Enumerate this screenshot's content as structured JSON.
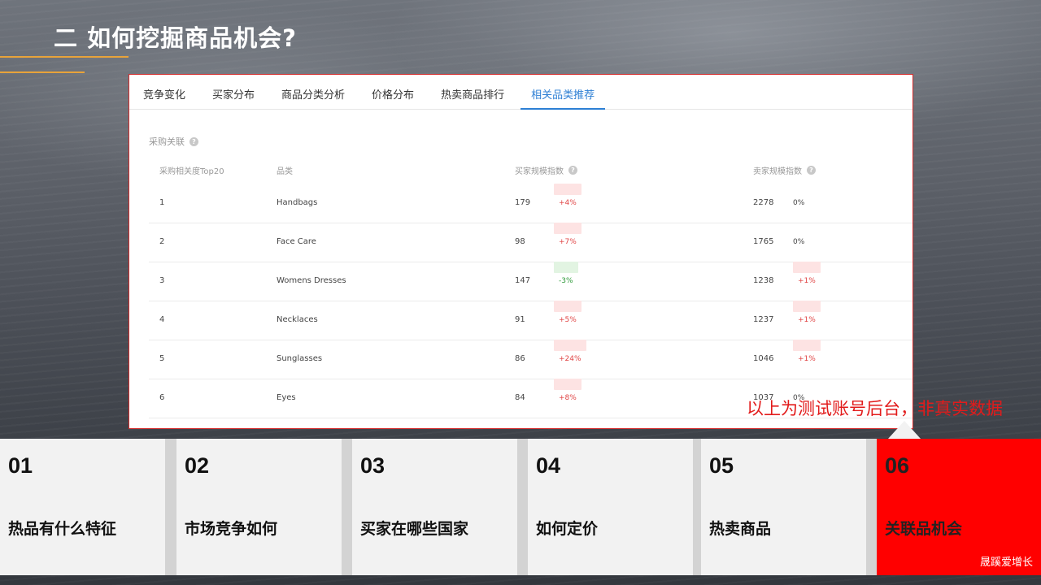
{
  "slide": {
    "title": "二 如何挖掘商品机会?",
    "disclaimer": "以上为测试账号后台，非真实数据",
    "brand": "晟蹊爱增长"
  },
  "tabs": [
    {
      "label": "竞争变化",
      "active": false
    },
    {
      "label": "买家分布",
      "active": false
    },
    {
      "label": "商品分类分析",
      "active": false
    },
    {
      "label": "价格分布",
      "active": false
    },
    {
      "label": "热卖商品排行",
      "active": false
    },
    {
      "label": "相关品类推荐",
      "active": true
    }
  ],
  "section": {
    "title": "采购关联",
    "headers": {
      "rank": "采购相关度Top20",
      "category": "品类",
      "buyer_index": "买家规模指数",
      "seller_index": "卖家规模指数"
    }
  },
  "rows": [
    {
      "rank": "1",
      "category": "Handbags",
      "buyer": "179",
      "buyer_change": "+4%",
      "buyer_trend": "up",
      "seller": "2278",
      "seller_change": "0%",
      "seller_trend": "flat"
    },
    {
      "rank": "2",
      "category": "Face Care",
      "buyer": "98",
      "buyer_change": "+7%",
      "buyer_trend": "up",
      "seller": "1765",
      "seller_change": "0%",
      "seller_trend": "flat"
    },
    {
      "rank": "3",
      "category": "Womens Dresses",
      "buyer": "147",
      "buyer_change": "-3%",
      "buyer_trend": "down",
      "seller": "1238",
      "seller_change": "+1%",
      "seller_trend": "up"
    },
    {
      "rank": "4",
      "category": "Necklaces",
      "buyer": "91",
      "buyer_change": "+5%",
      "buyer_trend": "up",
      "seller": "1237",
      "seller_change": "+1%",
      "seller_trend": "up"
    },
    {
      "rank": "5",
      "category": "Sunglasses",
      "buyer": "86",
      "buyer_change": "+24%",
      "buyer_trend": "up",
      "seller": "1046",
      "seller_change": "+1%",
      "seller_trend": "up"
    },
    {
      "rank": "6",
      "category": "Eyes",
      "buyer": "84",
      "buyer_change": "+8%",
      "buyer_trend": "up",
      "seller": "1037",
      "seller_change": "0%",
      "seller_trend": "flat"
    }
  ],
  "nav_cards": [
    {
      "num": "01",
      "label": "热品有什么特征",
      "active": false
    },
    {
      "num": "02",
      "label": "市场竞争如何",
      "active": false
    },
    {
      "num": "03",
      "label": "买家在哪些国家",
      "active": false
    },
    {
      "num": "04",
      "label": "如何定价",
      "active": false
    },
    {
      "num": "05",
      "label": "热卖商品",
      "active": false
    },
    {
      "num": "06",
      "label": "关联品机会",
      "active": true
    }
  ],
  "colors": {
    "accent_line": "#e8a33a",
    "tab_active": "#2d7fd4",
    "nav_active": "#ff0000",
    "disclaimer": "#e21b1b"
  }
}
